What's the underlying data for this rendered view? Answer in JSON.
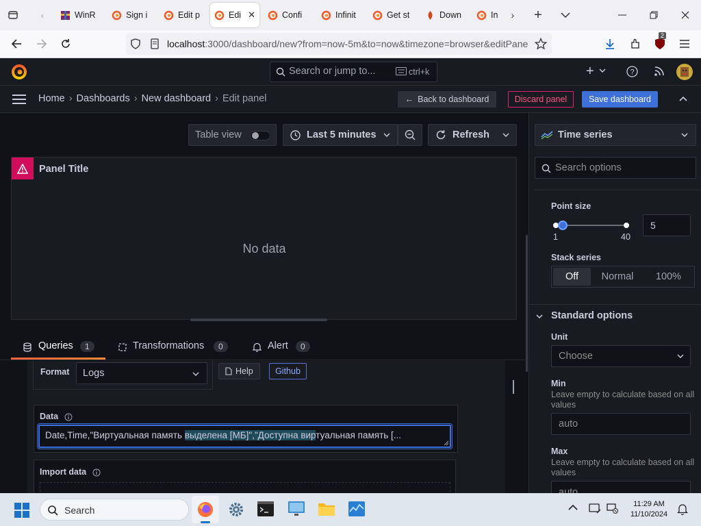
{
  "browser": {
    "tabs": [
      {
        "title": "WinR",
        "icon": "winrar-icon"
      },
      {
        "title": "Sign i",
        "icon": "grafana-icon"
      },
      {
        "title": "Edit p",
        "icon": "grafana-icon"
      },
      {
        "title": "Edi",
        "icon": "grafana-icon",
        "active": true
      },
      {
        "title": "Confi",
        "icon": "grafana-icon"
      },
      {
        "title": "Infinit",
        "icon": "grafana-icon"
      },
      {
        "title": "Get st",
        "icon": "grafana-icon"
      },
      {
        "title": "Down",
        "icon": "download-site-icon"
      },
      {
        "title": "Ins",
        "icon": "grafana-icon"
      }
    ],
    "url_host": "localhost",
    "url_rest": ":3000/dashboard/new?from=now-5m&to=now&timezone=browser&editPane",
    "extension_badge": "2"
  },
  "grafana": {
    "search_placeholder": "Search or jump to...",
    "search_shortcut": "ctrl+k",
    "breadcrumb": [
      "Home",
      "Dashboards",
      "New dashboard",
      "Edit panel"
    ],
    "back_button": "Back to dashboard",
    "discard_button": "Discard panel",
    "save_button": "Save dashboard",
    "toolbar": {
      "table_view": "Table view",
      "time_range": "Last 5 minutes",
      "refresh": "Refresh"
    },
    "panel": {
      "title": "Panel Title",
      "empty_text": "No data"
    },
    "tabs": [
      {
        "label": "Queries",
        "count": "1"
      },
      {
        "label": "Transformations",
        "count": "0"
      },
      {
        "label": "Alert",
        "count": "0"
      }
    ],
    "query": {
      "format_label": "Format",
      "format_value": "Logs",
      "help_button": "Help",
      "github_button": "Github",
      "data_label": "Data",
      "data_text_before": "Date,Time,\"Виртуальная память ",
      "data_text_highlight": "выделена [МБ]\",\"Доступна вир",
      "data_text_after": "туальная память [...",
      "import_label": "Import data"
    },
    "options": {
      "visualization": "Time series",
      "search_placeholder": "Search options",
      "point_size_label": "Point size",
      "point_size_min": "1",
      "point_size_max": "40",
      "point_size_value": "5",
      "point_size_fraction": 0.103,
      "stack_label": "Stack series",
      "stack_options": [
        "Off",
        "Normal",
        "100%"
      ],
      "stack_selected": "Off",
      "standard_section": "Standard options",
      "unit_label": "Unit",
      "unit_placeholder": "Choose",
      "min_label": "Min",
      "min_desc": "Leave empty to calculate based on all values",
      "min_placeholder": "auto",
      "max_label": "Max",
      "max_desc": "Leave empty to calculate based on all values",
      "max_placeholder": "auto"
    }
  },
  "taskbar": {
    "search_label": "Search",
    "time": "11:29 AM",
    "date": "11/10/2024"
  },
  "colors": {
    "grafana_orange": "#f05a28",
    "save_blue": "#3d71d9",
    "discard_red": "#e0226e",
    "warning_pink": "#d10e5c"
  }
}
